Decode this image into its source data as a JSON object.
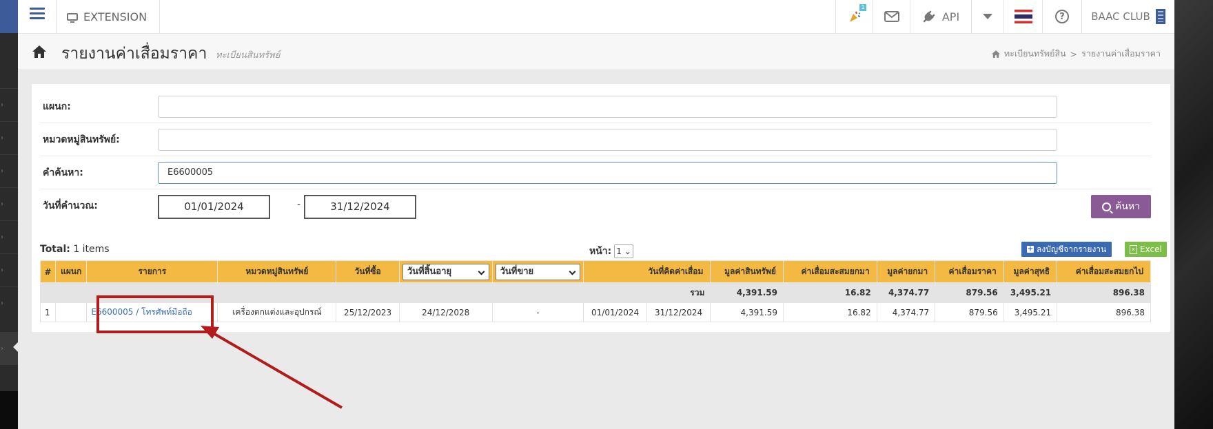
{
  "topbar": {
    "extension_label": "EXTENSION",
    "notification_count": "1",
    "api_label": "API",
    "org_label": "BAAC CLUB"
  },
  "page": {
    "title": "รายงานค่าเสื่อมราคา",
    "subtitle": "ทะเบียนสินทรัพย์",
    "breadcrumb": [
      "ทะเบียนทรัพย์สิน",
      "รายงานค่าเสื่อมราคา"
    ],
    "breadcrumb_sep": ">"
  },
  "filters": {
    "department_label": "แผนก:",
    "department_value": "",
    "category_label": "หมวดหมู่สินทรัพย์:",
    "category_value": "",
    "keyword_label": "คำค้นหา:",
    "keyword_value": "E6600005",
    "calc_date_label": "วันที่คำนวณ:",
    "date_from": "01/01/2024",
    "date_to": "31/12/2024",
    "date_sep": "-",
    "search_button": "ค้นหา"
  },
  "results": {
    "total_label": "Total:",
    "total_value": "1 items",
    "page_label": "หน้า:",
    "page_value": "1",
    "ledger_button": "ลงบัญชีจากรายงาน",
    "excel_button": "Excel"
  },
  "table": {
    "headers": {
      "no": "#",
      "department": "แผนก",
      "item": "รายการ",
      "category": "หมวดหมู่สินทรัพย์",
      "purchase_date": "วันที่ซื้อ",
      "expire_date": "วันที่สิ้นอายุ",
      "sale_date": "วันที่ขาย",
      "depr_period": "วันที่คิดค่าเสื่อม",
      "asset_value": "มูลค่าสินทรัพย์",
      "accum_bf": "ค่าเสื่อมสะสมยกมา",
      "value_bf": "มูลค่ายกมา",
      "depreciation": "ค่าเสื่อมราคา",
      "net_value": "มูลค่าสุทธิ",
      "accum_cf": "ค่าเสื่อมสะสมยกไป"
    },
    "summary": {
      "label": "รวม",
      "asset_value": "4,391.59",
      "accum_bf": "16.82",
      "value_bf": "4,374.77",
      "depreciation": "879.56",
      "net_value": "3,495.21",
      "accum_cf": "896.38"
    },
    "rows": [
      {
        "no": "1",
        "department": "",
        "item": "E6600005 / โทรศัพท์มือถือ",
        "category": "เครื่องตกแต่งและอุปกรณ์",
        "purchase_date": "25/12/2023",
        "expire_date": "24/12/2028",
        "sale_date": "-",
        "depr_from": "01/01/2024",
        "depr_to": "31/12/2024",
        "asset_value": "4,391.59",
        "accum_bf": "16.82",
        "value_bf": "4,374.77",
        "depreciation": "879.56",
        "net_value": "3,495.21",
        "accum_cf": "896.38"
      }
    ]
  },
  "colors": {
    "accent_purple": "#8a5a97",
    "header_orange": "#f4b942",
    "brand_blue": "#3d5a99",
    "excel_green": "#7cbf47",
    "annotation_red": "#b31b1b"
  },
  "icons": [
    "menu-icon",
    "monitor-icon",
    "party-icon",
    "mail-icon",
    "plug-icon",
    "caret-down-icon",
    "flag-icon",
    "help-icon",
    "building-icon",
    "home-icon",
    "search-icon",
    "plus-square-icon",
    "excel-icon"
  ]
}
